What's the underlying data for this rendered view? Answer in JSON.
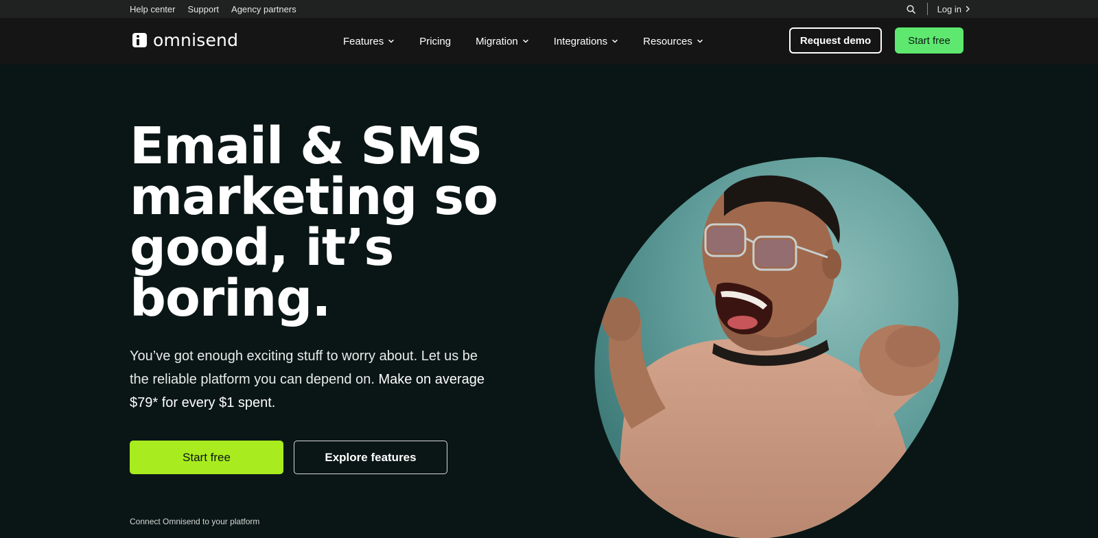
{
  "utility_bar": {
    "links": [
      "Help center",
      "Support",
      "Agency partners"
    ],
    "login_label": "Log in"
  },
  "nav": {
    "logo_text": "omnisend",
    "items": [
      {
        "label": "Features",
        "has_dropdown": true
      },
      {
        "label": "Pricing",
        "has_dropdown": false
      },
      {
        "label": "Migration",
        "has_dropdown": true
      },
      {
        "label": "Integrations",
        "has_dropdown": true
      },
      {
        "label": "Resources",
        "has_dropdown": true
      }
    ],
    "request_demo_label": "Request demo",
    "start_free_label": "Start free"
  },
  "hero": {
    "title_lines": [
      "Email & SMS",
      "marketing so",
      "good, it’s",
      "boring."
    ],
    "subtitle_regular": "You’ve got enough exciting stuff to worry about. Let us be the reliable platform you can depend on.",
    "subtitle_strong": "Make on average $79* for every $1 spent.",
    "primary_cta": "Start free",
    "secondary_cta": "Explore features",
    "connect_text": "Connect Omnisend to your platform"
  },
  "colors": {
    "page_bg": "#0a1615",
    "utility_bg": "#1f2220",
    "nav_bg": "#141514",
    "nav_cta": "#5ee86f",
    "hero_cta": "#a8ec1f",
    "image_bg": "#6fa9a6",
    "sweater": "#c99a82"
  },
  "icons": {
    "search": "search-icon",
    "login_chevron": "chevron-right-icon",
    "dropdown": "chevron-down-icon"
  }
}
